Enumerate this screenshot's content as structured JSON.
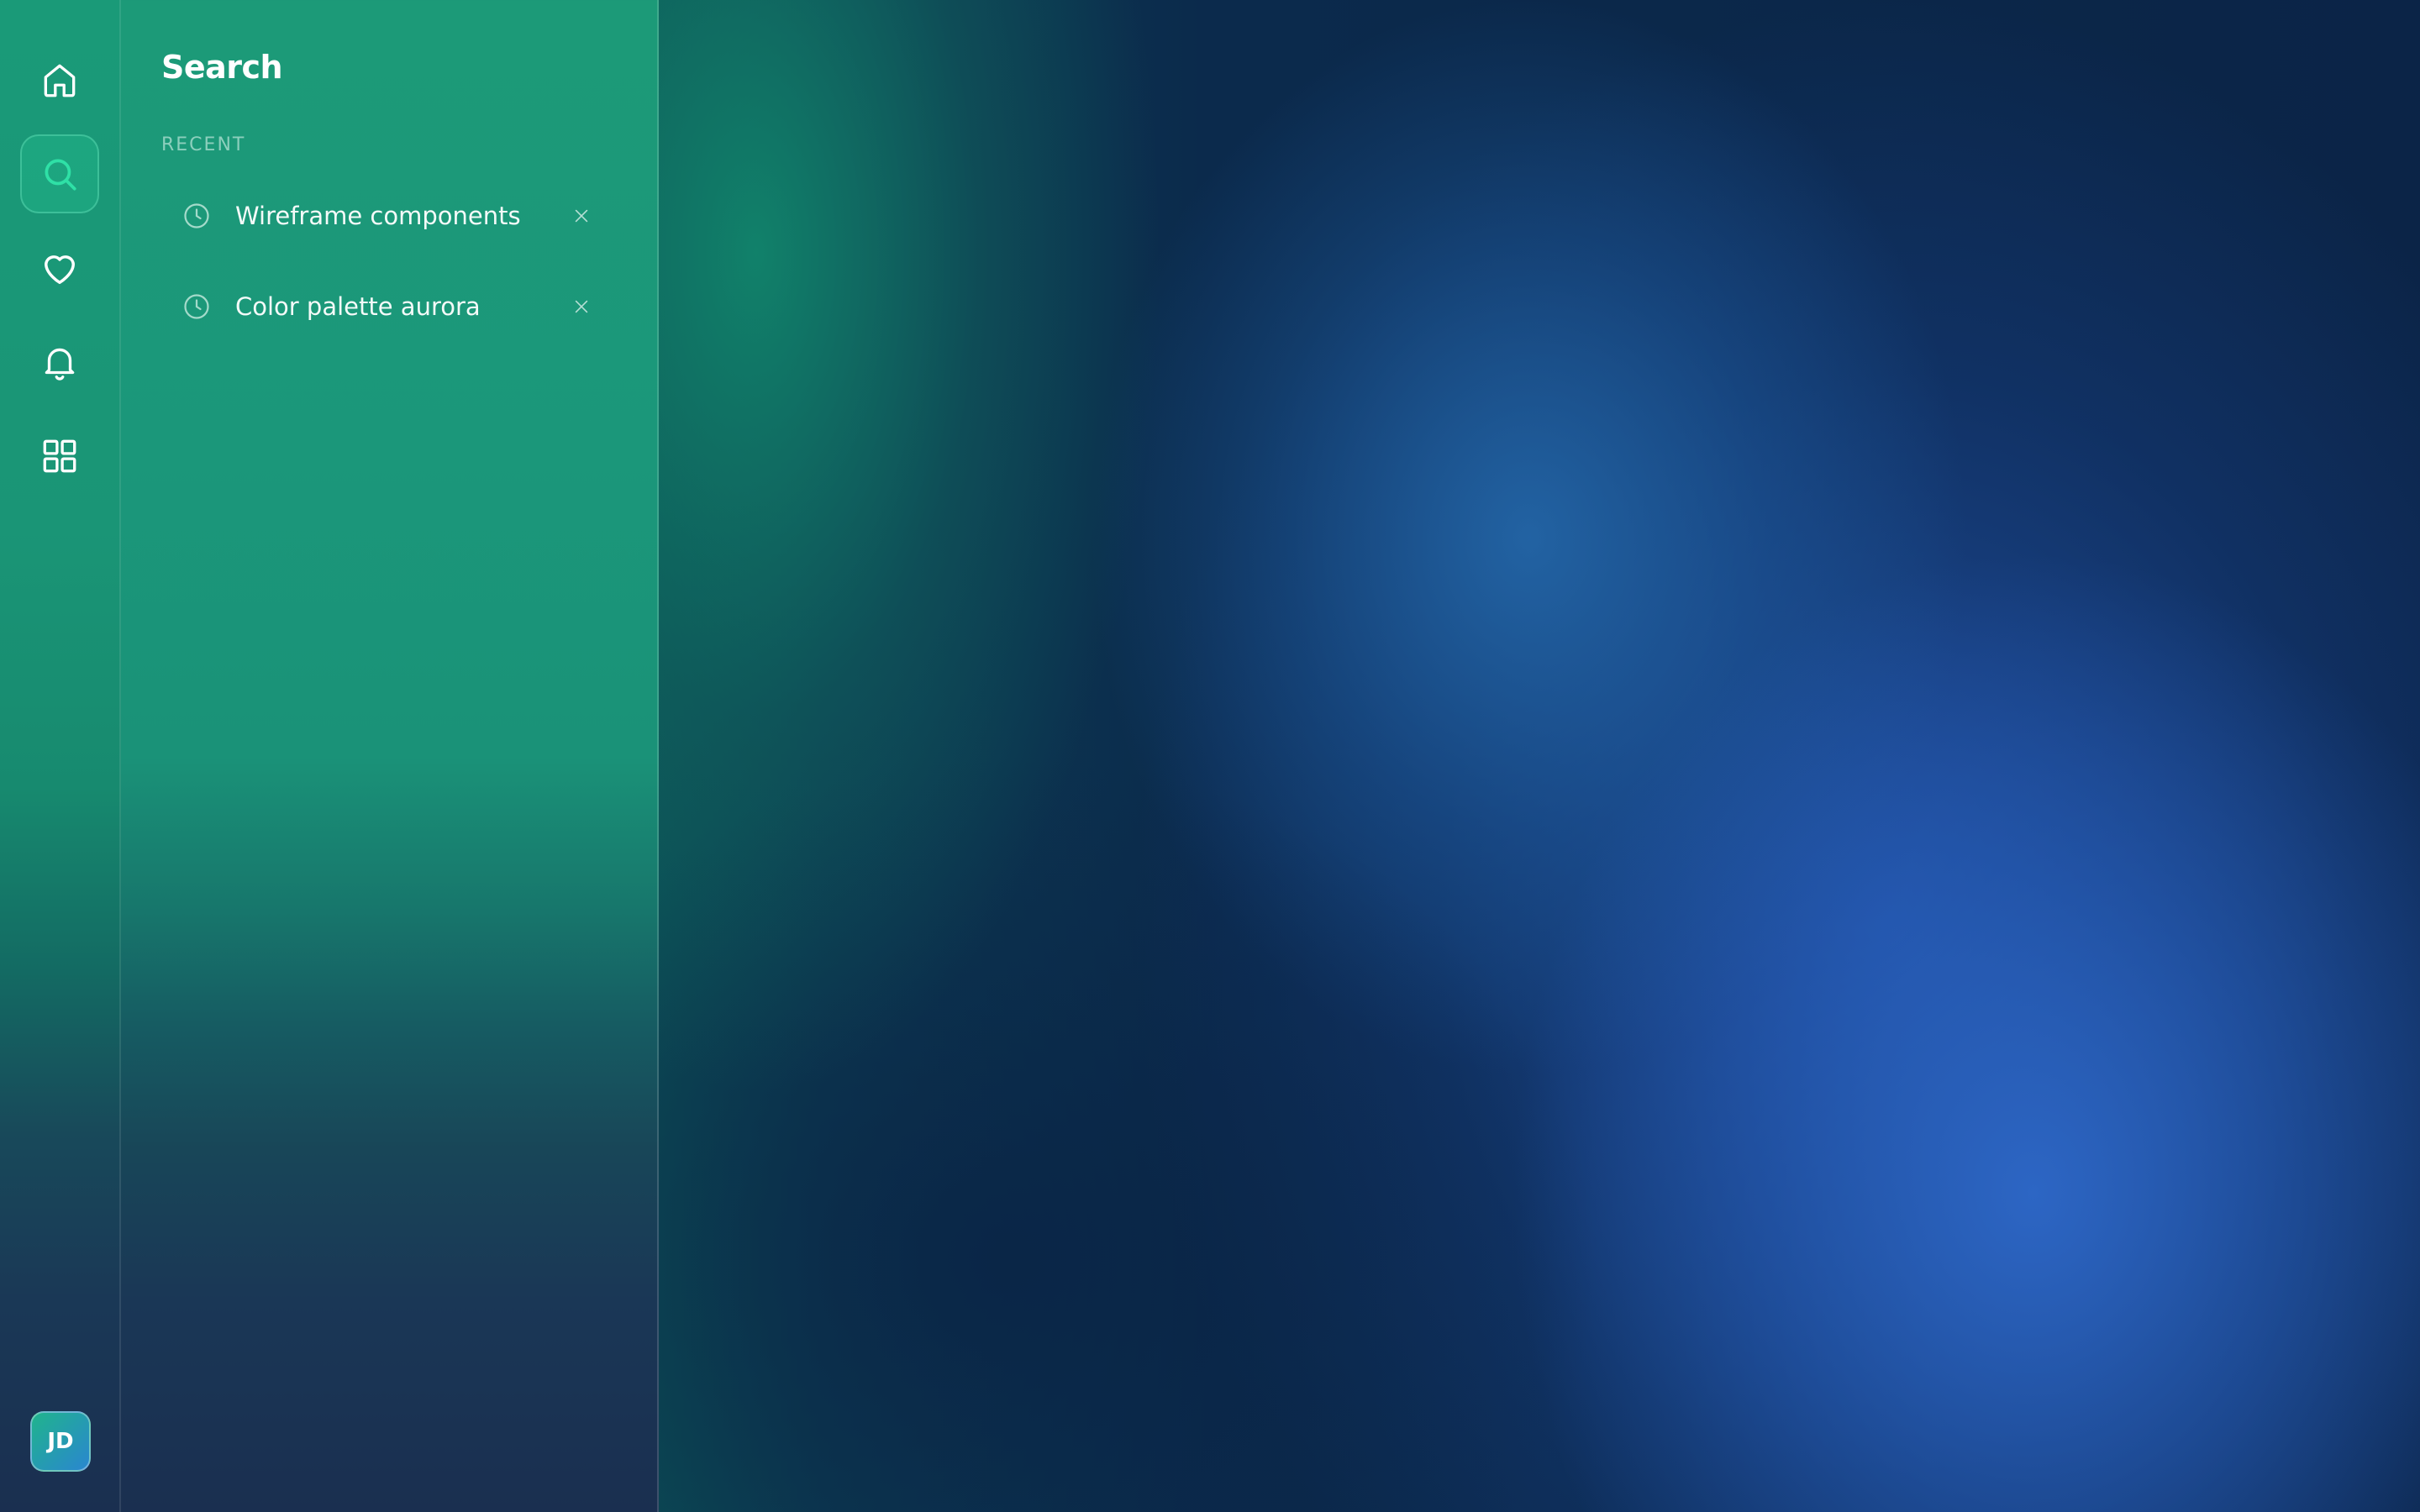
{
  "nav": {
    "items": [
      {
        "name": "home",
        "icon": "home-icon",
        "active": false
      },
      {
        "name": "search",
        "icon": "search-icon",
        "active": true
      },
      {
        "name": "favorites",
        "icon": "heart-icon",
        "active": false
      },
      {
        "name": "notifications",
        "icon": "bell-icon",
        "active": false
      },
      {
        "name": "apps",
        "icon": "grid-icon",
        "active": false
      }
    ],
    "avatar_initials": "JD"
  },
  "search_panel": {
    "title": "Search",
    "section_label": "RECENT",
    "recent": [
      {
        "label": "Wireframe components",
        "icon": "clock-icon",
        "remove_icon": "close-icon"
      },
      {
        "label": "Color palette aurora",
        "icon": "clock-icon",
        "remove_icon": "close-icon"
      }
    ]
  },
  "colors": {
    "accent": "#1fd19a",
    "panel_green": "#1c9a78",
    "background_blue": "#0b2447",
    "glow_blue": "#2e68c8"
  }
}
